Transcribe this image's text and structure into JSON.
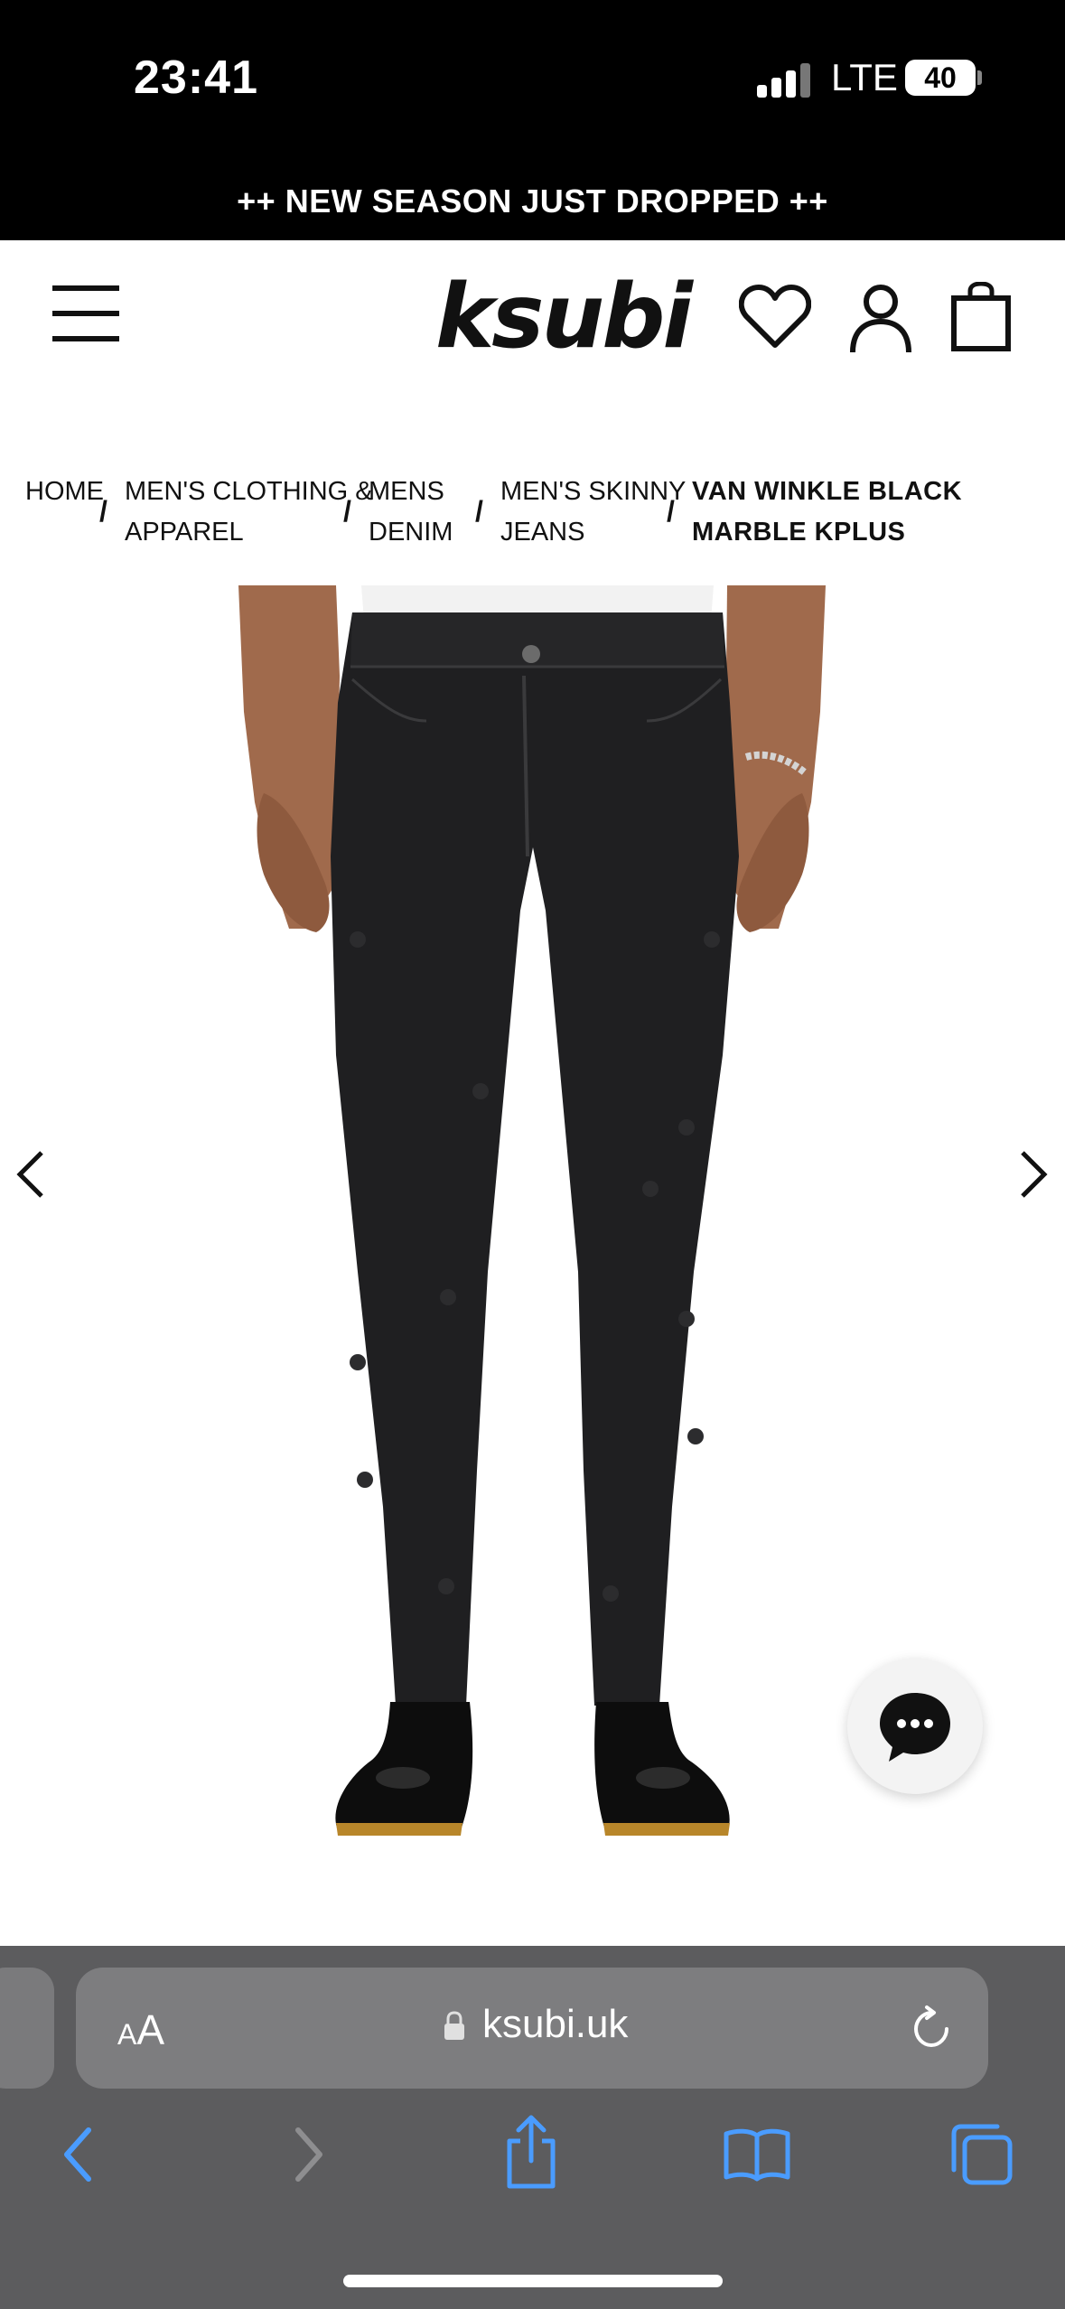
{
  "status_bar": {
    "time": "23:41",
    "network": "LTE",
    "battery": "40"
  },
  "promo_banner": "++ NEW SEASON JUST DROPPED ++",
  "header": {
    "logo": "ksubi",
    "icons": [
      "menu-icon",
      "heart-icon",
      "user-icon",
      "bag-icon"
    ]
  },
  "breadcrumb": {
    "items": [
      {
        "line1": "HOME",
        "line2": ""
      },
      {
        "line1": "MEN'S CLOTHING &",
        "line2": "APPAREL"
      },
      {
        "line1": "MENS",
        "line2": "DENIM"
      },
      {
        "line1": "MEN'S SKINNY",
        "line2": "JEANS"
      },
      {
        "line1": "VAN WINKLE BLACK",
        "line2": "MARBLE KPLUS"
      }
    ],
    "separator": "/"
  },
  "product_image": {
    "subject": "black skinny jeans with embroidered cross motifs, worn with black leather boots",
    "colors": {
      "denim": "#1f1f21",
      "shirt": "#f2f2f2",
      "skin": "#a06a4c"
    }
  },
  "browser": {
    "text_size_button": "AA",
    "url": "ksubi.uk",
    "toolbar_icons": [
      "back-icon",
      "forward-icon",
      "share-icon",
      "bookmarks-icon",
      "tabs-icon"
    ],
    "accent": "#4a9cff"
  }
}
